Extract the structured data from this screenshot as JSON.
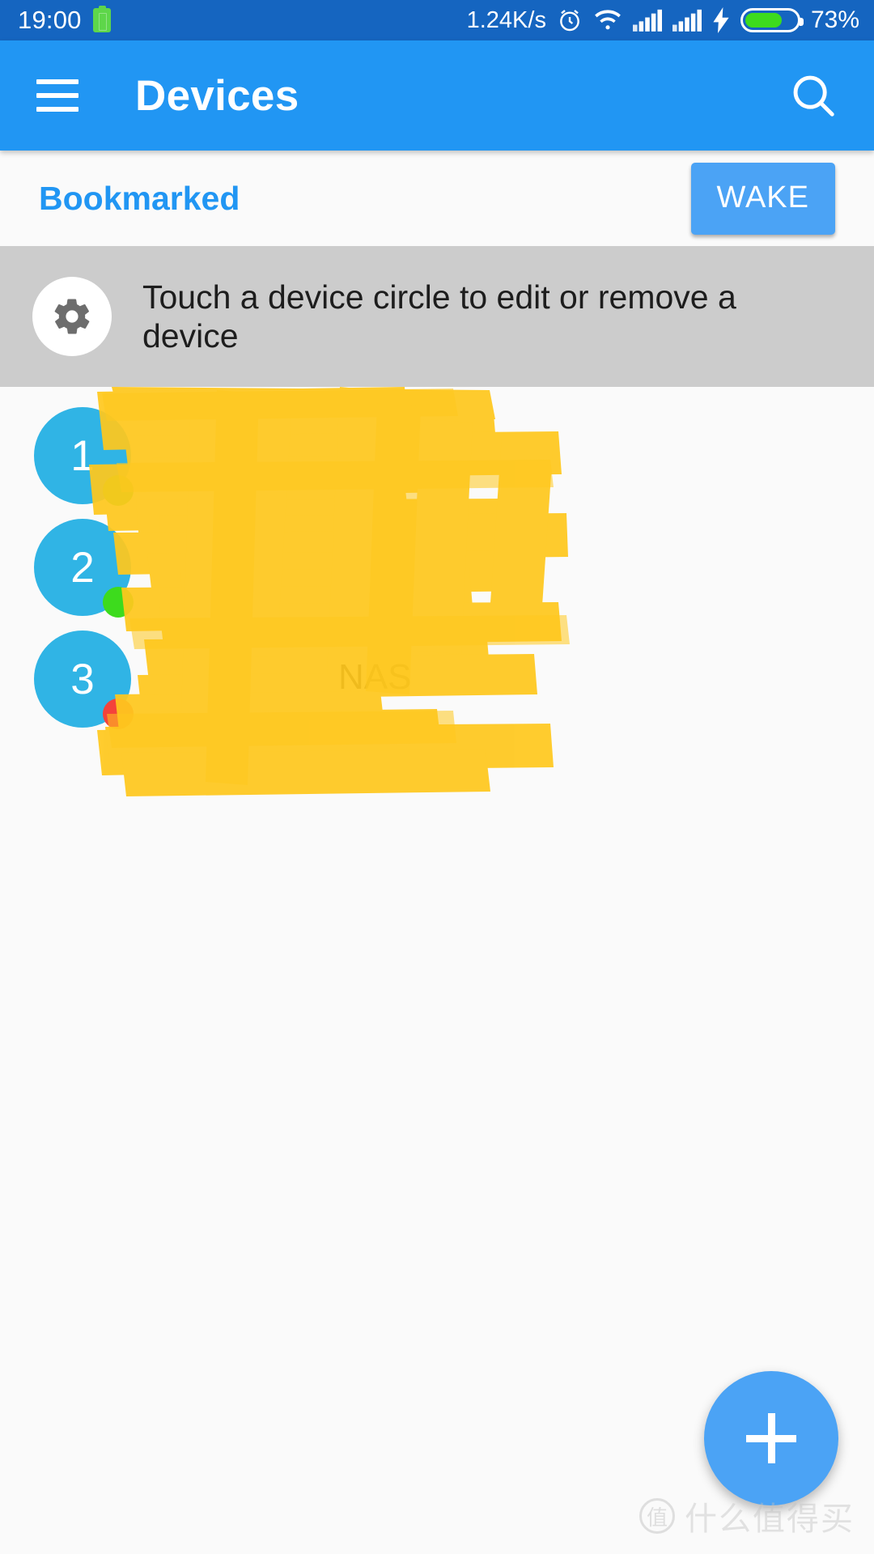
{
  "status_bar": {
    "clock": "19:00",
    "network_speed": "1.24K/s",
    "battery_percent": "73%",
    "icons": [
      "battery-saver-icon",
      "alarm-clock-icon",
      "wifi-icon",
      "signal-sim1-icon",
      "signal-sim2-icon",
      "charging-bolt-icon",
      "battery-icon"
    ],
    "bg_color": "#1565C0"
  },
  "app_bar": {
    "menu_label": "menu",
    "title": "Devices",
    "search_label": "search",
    "bg_color": "#2196F3"
  },
  "section": {
    "title": "Bookmarked",
    "wake_label": "WAKE",
    "accent_color": "#2196F3"
  },
  "info_banner": {
    "icon": "gear-icon",
    "text": "Touch a device circle to edit or remove a device",
    "bg_color": "#cccccc"
  },
  "devices": [
    {
      "index": "1",
      "status": "online",
      "status_color": "#3ddb1d",
      "name": "",
      "detail": "",
      "redacted": true
    },
    {
      "index": "2",
      "status": "online",
      "status_color": "#3ddb1d",
      "name": "",
      "detail": "",
      "redacted": true
    },
    {
      "index": "3",
      "status": "offline",
      "status_color": "#F4433B",
      "name": "NAS",
      "detail": "",
      "redacted": true
    }
  ],
  "redaction": {
    "color": "#FFC81E",
    "note": "hand-drawn yellow highlighter strokes covering device names, IP and MAC addresses"
  },
  "fab": {
    "label": "+",
    "icon": "plus-icon",
    "color": "#4BA3F5"
  },
  "watermark": {
    "badge": "值",
    "text": "什么值得买"
  }
}
